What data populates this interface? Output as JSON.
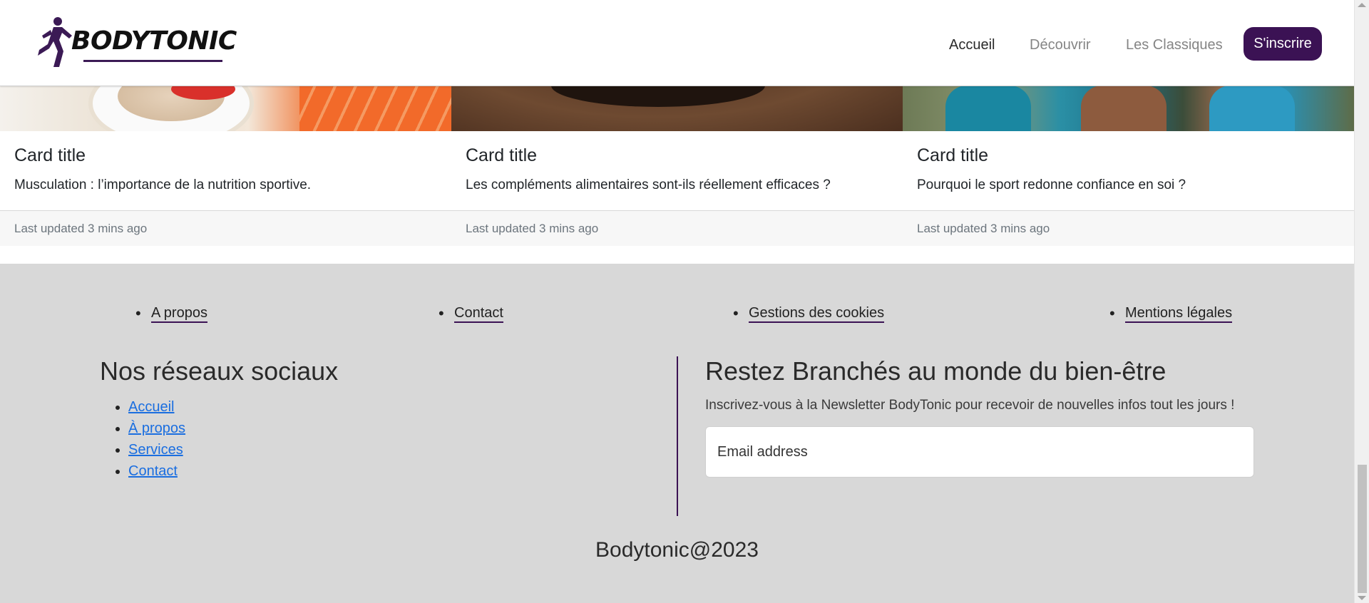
{
  "brand": {
    "logo_text": "BODYTONIC"
  },
  "nav": {
    "items": [
      {
        "label": "Accueil"
      },
      {
        "label": "Découvrir"
      },
      {
        "label": "Les Classiques"
      }
    ],
    "signup_label": "S'inscrire"
  },
  "cards": [
    {
      "title": "Card title",
      "text": "Musculation : l’importance de la nutrition sportive.",
      "footer": "Last updated 3 mins ago",
      "image": "protein-powder-and-salmon"
    },
    {
      "title": "Card title",
      "text": "Les compléments alimentaires sont-ils réellement efficaces ?",
      "footer": "Last updated 3 mins ago",
      "image": "supplements-on-wood"
    },
    {
      "title": "Card title",
      "text": "Pourquoi le sport redonne confiance en soi ?",
      "footer": "Last updated 3 mins ago",
      "image": "runners-group"
    }
  ],
  "footer": {
    "links": [
      {
        "label": "A propos"
      },
      {
        "label": "Contact"
      },
      {
        "label": "Gestions des cookies"
      },
      {
        "label": "Mentions légales"
      }
    ],
    "social": {
      "title": "Nos réseaux sociaux",
      "items": [
        {
          "label": "Accueil"
        },
        {
          "label": "À propos"
        },
        {
          "label": "Services"
        },
        {
          "label": "Contact"
        }
      ]
    },
    "newsletter": {
      "title": "Restez Branchés au monde du bien-être",
      "text": "Inscrivez-vous à la Newsletter BodyTonic pour recevoir de nouvelles infos tout les jours !",
      "email_placeholder": "Email address"
    },
    "copyright": "Bodytonic@2023"
  },
  "colors": {
    "brand": "#3b1254",
    "footer_bg": "#d8d8d8",
    "link": "#1a6ee0"
  }
}
